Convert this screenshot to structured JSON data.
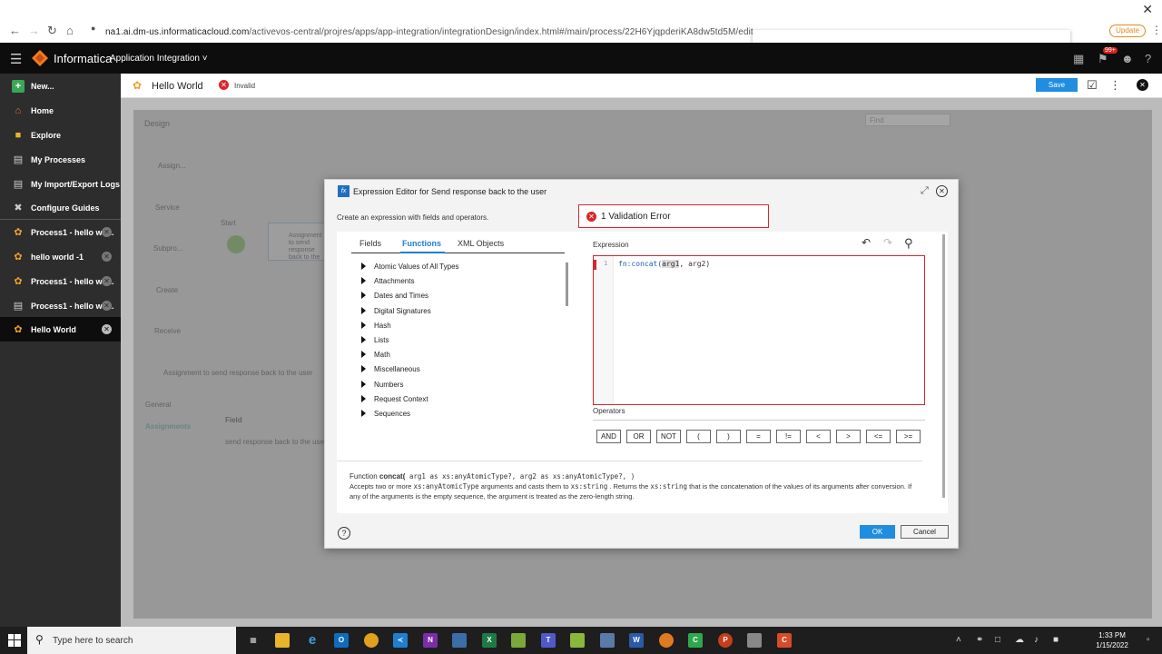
{
  "browser": {
    "url_host": "na1.ai.dm-us.informaticacloud.com",
    "url_path": "/activevos-central/projres/apps/app-integration/integrationDesign/index.html#/main/process/22H6YjqpderiKA8dw5td5M/edit",
    "update_label": "Update"
  },
  "header": {
    "brand": "Informatica",
    "app_name": "Application Integration",
    "badge": "99+"
  },
  "sidebar": {
    "items": [
      {
        "label": "New..."
      },
      {
        "label": "Home"
      },
      {
        "label": "Explore"
      },
      {
        "label": "My Processes"
      },
      {
        "label": "My Import/Export Logs"
      },
      {
        "label": "Configure Guides"
      },
      {
        "label": "Process1 - hello wo..."
      },
      {
        "label": "hello world -1"
      },
      {
        "label": "Process1 - hello wo..."
      },
      {
        "label": "Process1 - hello wo..."
      },
      {
        "label": "Hello World"
      }
    ]
  },
  "page": {
    "title": "Hello World",
    "status": "Invalid",
    "save_label": "Save"
  },
  "canvas": {
    "design_label": "Design",
    "find_placeholder": "Find",
    "palette": [
      "Assign...",
      "Service",
      "Subpro...",
      "Create",
      "Receive"
    ],
    "start_label": "Start",
    "node_label": "Assignment to send response back to the user",
    "props_title": "Assignment to send response back to the user",
    "tabs": [
      "General",
      "Assignments"
    ],
    "field_header": "Field",
    "field_value": "send response back to the user"
  },
  "dialog": {
    "title": "Expression Editor for Send response back to the user",
    "subtitle": "Create an expression with fields and operators.",
    "validation_error": "1 Validation Error",
    "tabs": [
      "Fields",
      "Functions",
      "XML Objects"
    ],
    "functions": [
      "Atomic Values of All Types",
      "Attachments",
      "Dates and Times",
      "Digital Signatures",
      "Hash",
      "Lists",
      "Math",
      "Miscellaneous",
      "Numbers",
      "Request Context",
      "Sequences"
    ],
    "expression_label": "Expression",
    "line_number": "1",
    "code_fn": "fn:concat(",
    "code_hl": "arg1",
    "code_rest": ", arg2)",
    "operators_label": "Operators",
    "operators": [
      "AND",
      "OR",
      "NOT",
      "(",
      ")",
      "=",
      "!=",
      "<",
      ">",
      "<=",
      ">="
    ],
    "desc_prefix": "Function ",
    "desc_fn": "concat(",
    "desc_sig": " arg1 as xs:anyAtomicType?, arg2 as xs:anyAtomicType?, )",
    "desc_body1": "Accepts two or more ",
    "desc_mono1": "xs:anyAtomicType",
    "desc_body2": " arguments and casts them to ",
    "desc_mono2": "xs:string",
    "desc_body3": " . Returns the ",
    "desc_mono3": "xs:string",
    "desc_body4": " that is the concatenation of the values of its arguments after conversion. If any of the arguments is the empty sequence, the argument is treated as the zero-length string.",
    "ok_label": "OK",
    "cancel_label": "Cancel"
  },
  "taskbar": {
    "search_placeholder": "Type here to search",
    "time": "1:33 PM",
    "date": "1/15/2022"
  },
  "colors": {
    "accent": "#1f8de0",
    "error": "#d9262b",
    "sidebar": "#2d2d2d"
  }
}
